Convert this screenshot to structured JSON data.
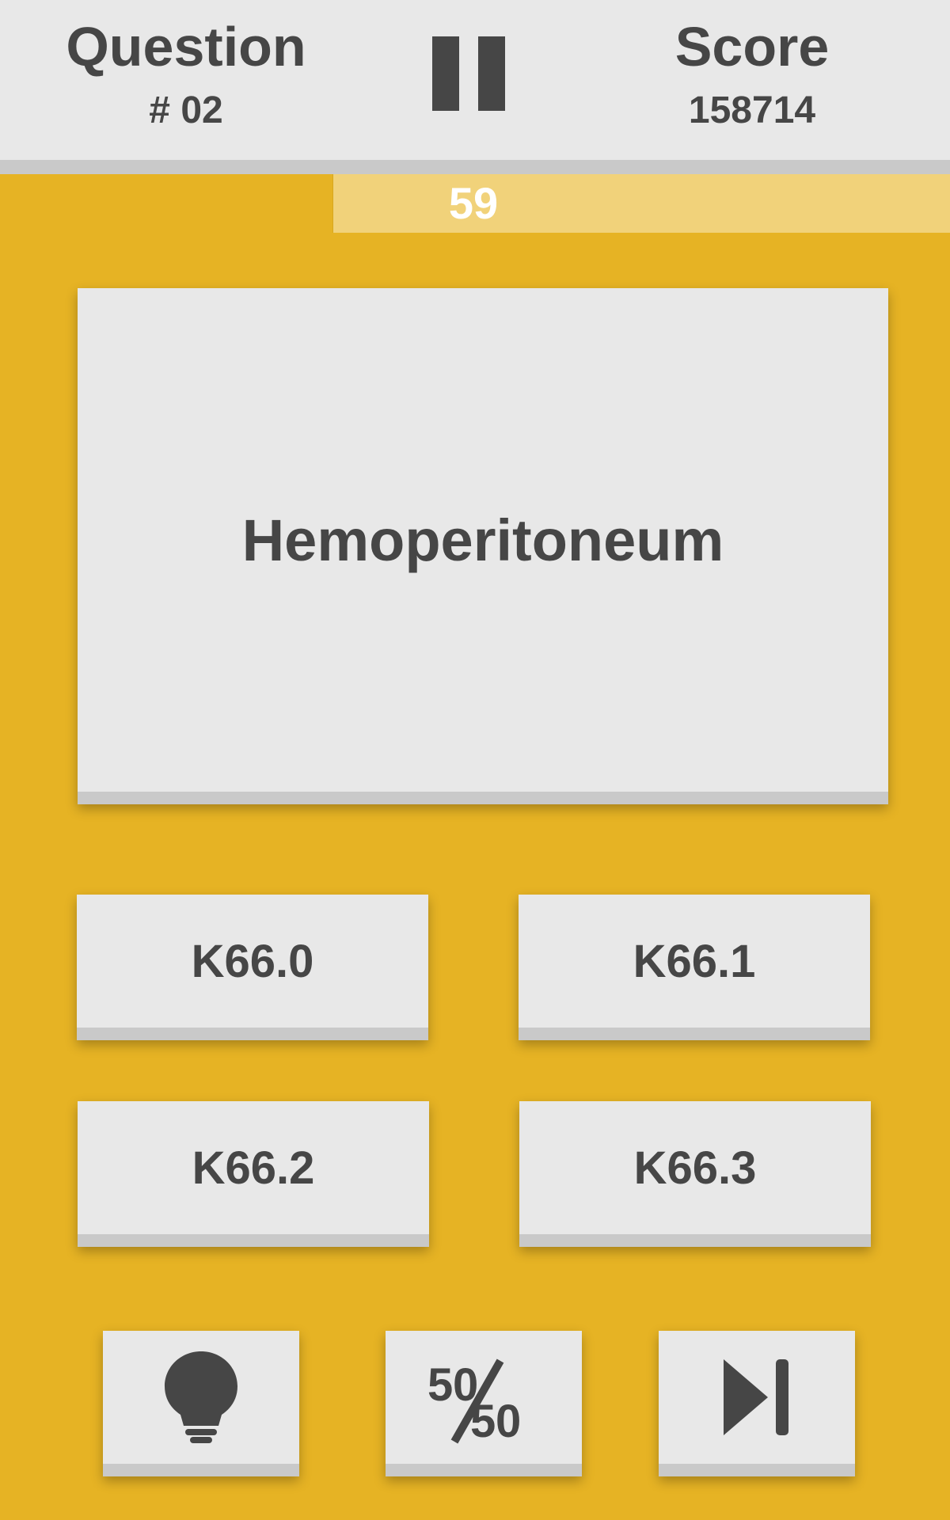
{
  "header": {
    "question_label": "Question",
    "question_number": "# 02",
    "score_label": "Score",
    "score_value": "158714",
    "pause_icon": "pause-icon"
  },
  "timer": {
    "value": "59",
    "remaining_fraction": 0.35
  },
  "question": {
    "term": "Hemoperitoneum"
  },
  "answers": [
    {
      "label": "K66.0"
    },
    {
      "label": "K66.1"
    },
    {
      "label": "K66.2"
    },
    {
      "label": "K66.3"
    }
  ],
  "tools": {
    "hint_icon": "lightbulb-icon",
    "fifty_fifty_icon": "fifty-fifty-icon",
    "skip_icon": "skip-next-icon"
  },
  "colors": {
    "background": "#E6B324",
    "timer_track": "#F1D27A",
    "card": "#E8E8E8",
    "card_edge": "#C9C9C9",
    "text": "#464646"
  }
}
